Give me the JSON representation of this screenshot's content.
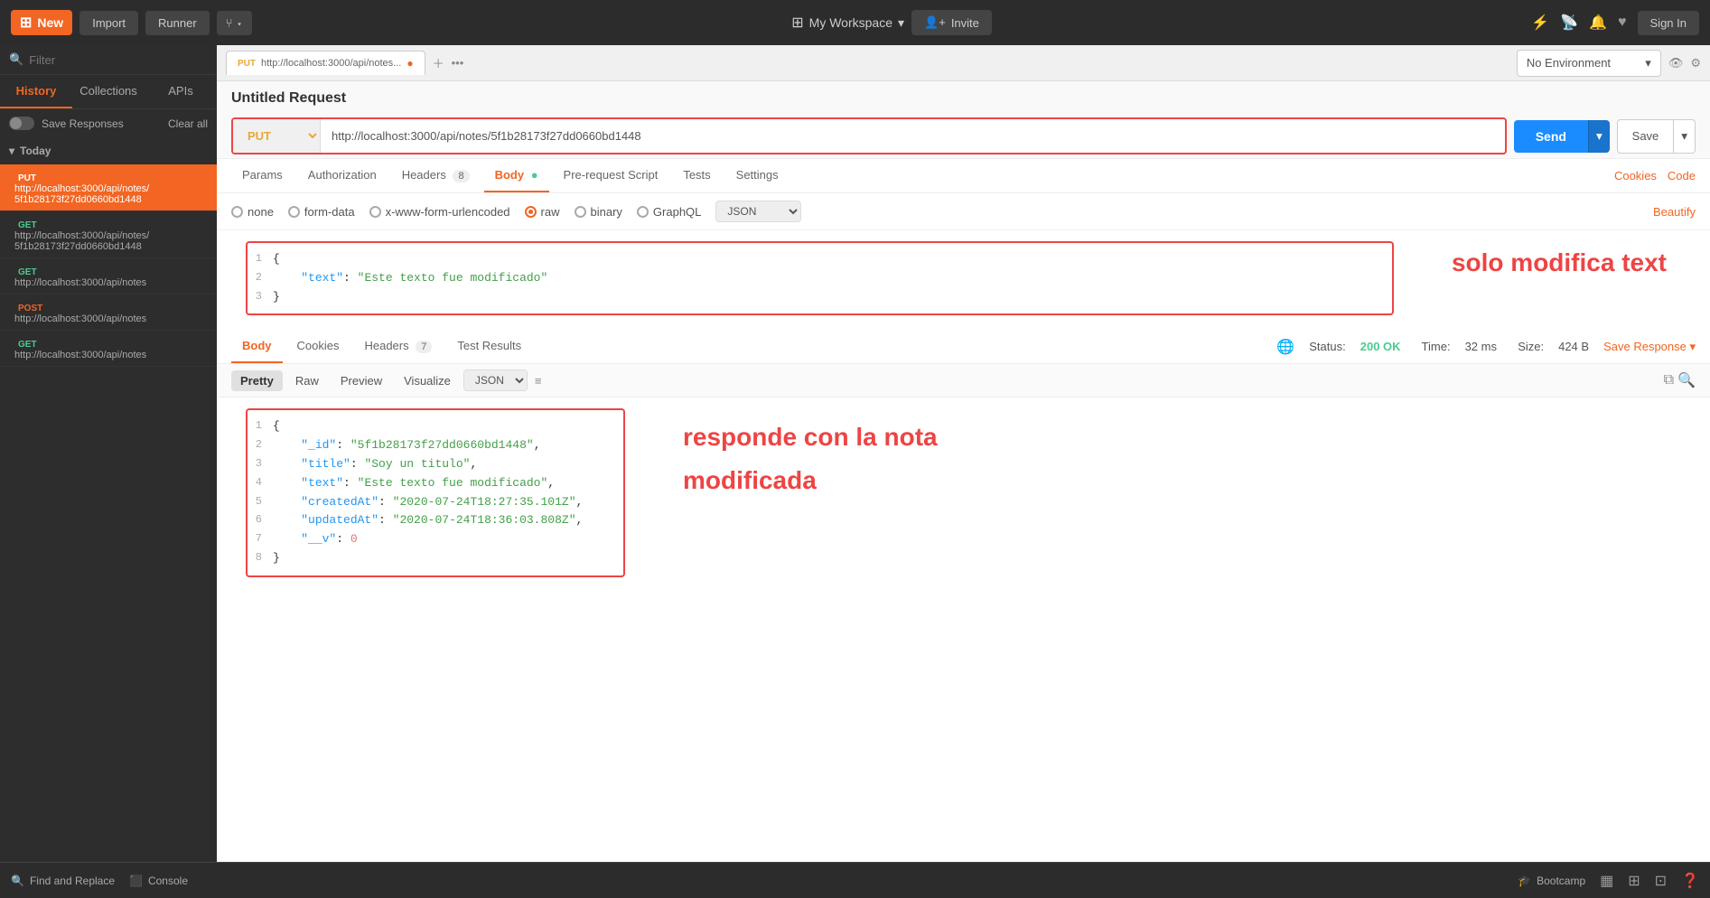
{
  "topbar": {
    "new_label": "New",
    "import_label": "Import",
    "runner_label": "Runner",
    "workspace_label": "My Workspace",
    "invite_label": "Invite",
    "sign_in_label": "Sign In"
  },
  "sidebar": {
    "filter_placeholder": "Filter",
    "tabs": [
      "History",
      "Collections",
      "APIs"
    ],
    "active_tab": "History",
    "save_responses_label": "Save Responses",
    "clear_all_label": "Clear all",
    "section_label": "Today",
    "history_items": [
      {
        "method": "PUT",
        "url": "http://localhost:3000/api/notes/5f1b28173f27dd0660bd1448",
        "active": true
      },
      {
        "method": "GET",
        "url": "http://localhost:3000/api/notes/5f1b28173f27dd0660bd1448",
        "active": false
      },
      {
        "method": "GET",
        "url": "http://localhost:3000/api/notes",
        "active": false
      },
      {
        "method": "POST",
        "url": "http://localhost:3000/api/notes",
        "active": false
      },
      {
        "method": "GET",
        "url": "http://localhost:3000/api/notes",
        "active": false
      }
    ]
  },
  "request_tab": {
    "method": "PUT",
    "url_short": "http://localhost:3000/api/notes...",
    "url_full": "http://localhost:3000/api/notes/5f1b28173f27dd0660bd1448",
    "title": "Untitled Request"
  },
  "env": {
    "label": "No Environment"
  },
  "nav_tabs": {
    "tabs": [
      "Params",
      "Authorization",
      "Headers (8)",
      "Body",
      "Pre-request Script",
      "Tests",
      "Settings"
    ],
    "active": "Body",
    "right_links": [
      "Cookies",
      "Code"
    ]
  },
  "body_options": {
    "options": [
      "none",
      "form-data",
      "x-www-form-urlencoded",
      "raw",
      "binary",
      "GraphQL"
    ],
    "selected": "raw",
    "format": "JSON",
    "beautify_label": "Beautify"
  },
  "request_body": {
    "lines": [
      {
        "num": "1",
        "content": "{"
      },
      {
        "num": "2",
        "content": "    \"text\": \"Este texto fue modificado\""
      },
      {
        "num": "3",
        "content": "}"
      }
    ]
  },
  "request_annotation": "solo modifica text",
  "response": {
    "tabs": [
      "Body",
      "Cookies",
      "Headers (7)",
      "Test Results"
    ],
    "active_tab": "Body",
    "status": "200 OK",
    "time": "32 ms",
    "size": "424 B",
    "save_response_label": "Save Response"
  },
  "pretty_tabs": {
    "tabs": [
      "Pretty",
      "Raw",
      "Preview",
      "Visualize"
    ],
    "active": "Pretty",
    "format": "JSON"
  },
  "response_body": {
    "lines": [
      {
        "num": "1",
        "content": "{"
      },
      {
        "num": "2",
        "content": "    \"_id\": \"5f1b28173f27dd0660bd1448\","
      },
      {
        "num": "3",
        "content": "    \"title\": \"Soy un titulo\","
      },
      {
        "num": "4",
        "content": "    \"text\": \"Este texto fue modificado\","
      },
      {
        "num": "5",
        "content": "    \"createdAt\": \"2020-07-24T18:27:35.101Z\","
      },
      {
        "num": "6",
        "content": "    \"updatedAt\": \"2020-07-24T18:36:03.808Z\","
      },
      {
        "num": "7",
        "content": "    \"__v\": 0"
      },
      {
        "num": "8",
        "content": "}"
      }
    ]
  },
  "response_annotation_line1": "responde con la nota",
  "response_annotation_line2": "modificada",
  "bottombar": {
    "find_replace_label": "Find and Replace",
    "console_label": "Console",
    "bootcamp_label": "Bootcamp"
  },
  "send_label": "Send",
  "save_label": "Save"
}
